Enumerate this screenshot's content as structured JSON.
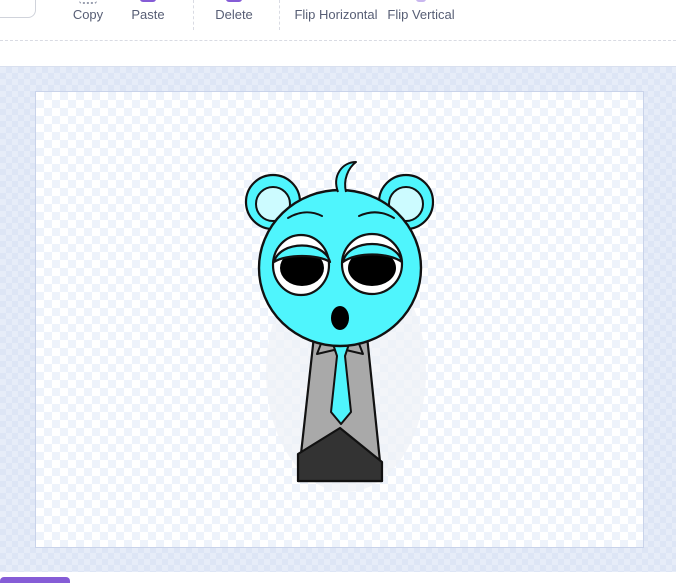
{
  "toolbar": {
    "copy_label": "Copy",
    "paste_label": "Paste",
    "delete_label": "Delete",
    "flip_horizontal_label": "Flip Horizontal",
    "flip_vertical_label": "Flip Vertical",
    "accent_color": "#855cd6",
    "text_color": "#575e75"
  },
  "canvas": {
    "background_color": "#e6ecf8"
  },
  "character": {
    "skin_color": "#4ff5fd",
    "suit_color": "#a9a9a9",
    "tie_color": "#4ff5fd",
    "pants_color": "#333333"
  }
}
